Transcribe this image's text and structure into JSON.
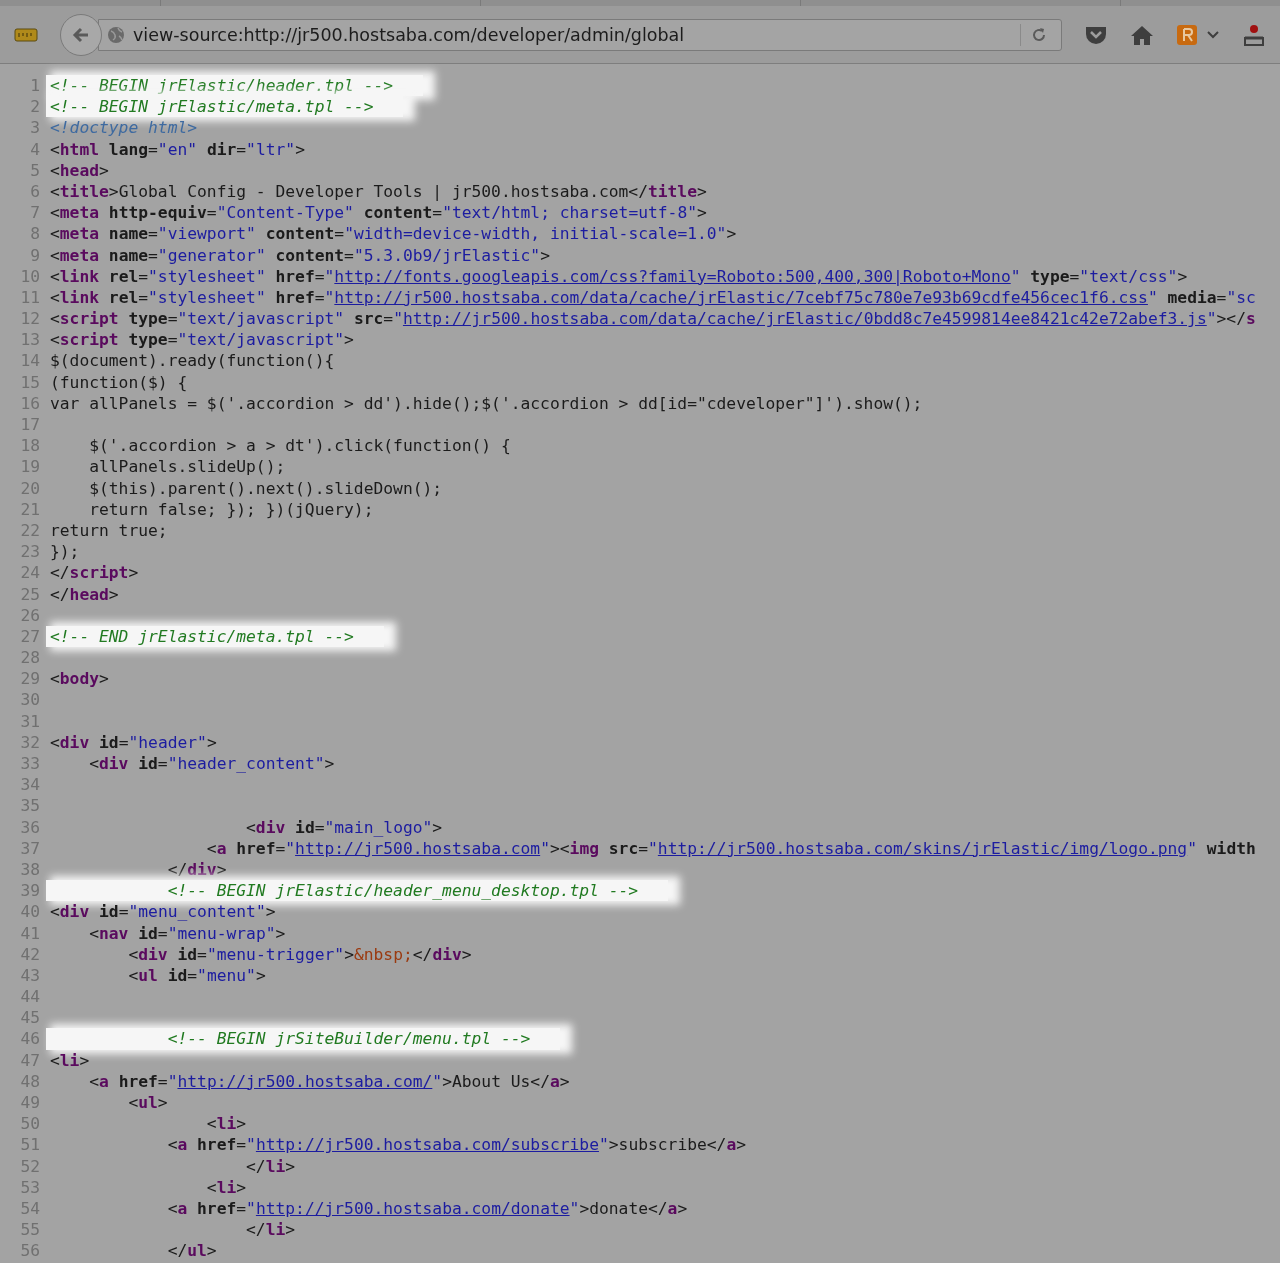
{
  "toolbar": {
    "url": "view-source:http://jr500.hostsaba.com/developer/admin/global"
  },
  "source_lines": [
    {
      "number": "1",
      "highlighted": true,
      "tokens": [
        {
          "kind": "comment",
          "text": "<!-- BEGIN jrElastic/header.tpl -->"
        }
      ]
    },
    {
      "number": "2",
      "highlighted": true,
      "tokens": [
        {
          "kind": "comment",
          "text": "<!-- BEGIN jrElastic/meta.tpl -->"
        }
      ]
    },
    {
      "number": "3",
      "highlighted": false,
      "tokens": [
        {
          "kind": "doctype",
          "text": "<!doctype html>"
        }
      ]
    },
    {
      "number": "4",
      "highlighted": false,
      "tokens": [
        {
          "kind": "plain",
          "text": "<"
        },
        {
          "kind": "tag",
          "text": "html"
        },
        {
          "kind": "attr",
          "text": " lang"
        },
        {
          "kind": "plain",
          "text": "="
        },
        {
          "kind": "value",
          "text": "\"en\""
        },
        {
          "kind": "attr",
          "text": " dir"
        },
        {
          "kind": "plain",
          "text": "="
        },
        {
          "kind": "value",
          "text": "\"ltr\""
        },
        {
          "kind": "plain",
          "text": ">"
        }
      ]
    },
    {
      "number": "5",
      "highlighted": false,
      "tokens": [
        {
          "kind": "plain",
          "text": "<"
        },
        {
          "kind": "tag",
          "text": "head"
        },
        {
          "kind": "plain",
          "text": ">"
        }
      ]
    },
    {
      "number": "6",
      "highlighted": false,
      "tokens": [
        {
          "kind": "plain",
          "text": "<"
        },
        {
          "kind": "tag",
          "text": "title"
        },
        {
          "kind": "plain",
          "text": ">Global Config - Developer Tools | jr500.hostsaba.com</"
        },
        {
          "kind": "tag",
          "text": "title"
        },
        {
          "kind": "plain",
          "text": ">"
        }
      ]
    },
    {
      "number": "7",
      "highlighted": false,
      "tokens": [
        {
          "kind": "plain",
          "text": "<"
        },
        {
          "kind": "tag",
          "text": "meta"
        },
        {
          "kind": "attr",
          "text": " http-equiv"
        },
        {
          "kind": "plain",
          "text": "="
        },
        {
          "kind": "value",
          "text": "\"Content-Type\""
        },
        {
          "kind": "attr",
          "text": " content"
        },
        {
          "kind": "plain",
          "text": "="
        },
        {
          "kind": "value",
          "text": "\"text/html; charset=utf-8\""
        },
        {
          "kind": "plain",
          "text": ">"
        }
      ]
    },
    {
      "number": "8",
      "highlighted": false,
      "tokens": [
        {
          "kind": "plain",
          "text": "<"
        },
        {
          "kind": "tag",
          "text": "meta"
        },
        {
          "kind": "attr",
          "text": " name"
        },
        {
          "kind": "plain",
          "text": "="
        },
        {
          "kind": "value",
          "text": "\"viewport\""
        },
        {
          "kind": "attr",
          "text": " content"
        },
        {
          "kind": "plain",
          "text": "="
        },
        {
          "kind": "value",
          "text": "\"width=device-width, initial-scale=1.0\""
        },
        {
          "kind": "plain",
          "text": ">"
        }
      ]
    },
    {
      "number": "9",
      "highlighted": false,
      "tokens": [
        {
          "kind": "plain",
          "text": "<"
        },
        {
          "kind": "tag",
          "text": "meta"
        },
        {
          "kind": "attr",
          "text": " name"
        },
        {
          "kind": "plain",
          "text": "="
        },
        {
          "kind": "value",
          "text": "\"generator\""
        },
        {
          "kind": "attr",
          "text": " content"
        },
        {
          "kind": "plain",
          "text": "="
        },
        {
          "kind": "value",
          "text": "\"5.3.0b9/jrElastic\""
        },
        {
          "kind": "plain",
          "text": ">"
        }
      ]
    },
    {
      "number": "10",
      "highlighted": false,
      "tokens": [
        {
          "kind": "plain",
          "text": "<"
        },
        {
          "kind": "tag",
          "text": "link"
        },
        {
          "kind": "attr",
          "text": " rel"
        },
        {
          "kind": "plain",
          "text": "="
        },
        {
          "kind": "value",
          "text": "\"stylesheet\""
        },
        {
          "kind": "attr",
          "text": " href"
        },
        {
          "kind": "plain",
          "text": "="
        },
        {
          "kind": "value",
          "text": "\""
        },
        {
          "kind": "link",
          "text": "http://fonts.googleapis.com/css?family=Roboto:500,400,300|Roboto+Mono"
        },
        {
          "kind": "value",
          "text": "\""
        },
        {
          "kind": "attr",
          "text": " type"
        },
        {
          "kind": "plain",
          "text": "="
        },
        {
          "kind": "value",
          "text": "\"text/css\""
        },
        {
          "kind": "plain",
          "text": ">"
        }
      ]
    },
    {
      "number": "11",
      "highlighted": false,
      "tokens": [
        {
          "kind": "plain",
          "text": "<"
        },
        {
          "kind": "tag",
          "text": "link"
        },
        {
          "kind": "attr",
          "text": " rel"
        },
        {
          "kind": "plain",
          "text": "="
        },
        {
          "kind": "value",
          "text": "\"stylesheet\""
        },
        {
          "kind": "attr",
          "text": " href"
        },
        {
          "kind": "plain",
          "text": "="
        },
        {
          "kind": "value",
          "text": "\""
        },
        {
          "kind": "link",
          "text": "http://jr500.hostsaba.com/data/cache/jrElastic/7cebf75c780e7e93b69cdfe456cec1f6.css"
        },
        {
          "kind": "value",
          "text": "\""
        },
        {
          "kind": "attr",
          "text": " media"
        },
        {
          "kind": "plain",
          "text": "="
        },
        {
          "kind": "value",
          "text": "\"sc"
        }
      ]
    },
    {
      "number": "12",
      "highlighted": false,
      "tokens": [
        {
          "kind": "plain",
          "text": "<"
        },
        {
          "kind": "tag",
          "text": "script"
        },
        {
          "kind": "attr",
          "text": " type"
        },
        {
          "kind": "plain",
          "text": "="
        },
        {
          "kind": "value",
          "text": "\"text/javascript\""
        },
        {
          "kind": "attr",
          "text": " src"
        },
        {
          "kind": "plain",
          "text": "="
        },
        {
          "kind": "value",
          "text": "\""
        },
        {
          "kind": "link",
          "text": "http://jr500.hostsaba.com/data/cache/jrElastic/0bdd8c7e4599814ee8421c42e72abef3.js"
        },
        {
          "kind": "value",
          "text": "\""
        },
        {
          "kind": "plain",
          "text": "></"
        },
        {
          "kind": "tag",
          "text": "s"
        }
      ]
    },
    {
      "number": "13",
      "highlighted": false,
      "tokens": [
        {
          "kind": "plain",
          "text": "<"
        },
        {
          "kind": "tag",
          "text": "script"
        },
        {
          "kind": "attr",
          "text": " type"
        },
        {
          "kind": "plain",
          "text": "="
        },
        {
          "kind": "value",
          "text": "\"text/javascript\""
        },
        {
          "kind": "plain",
          "text": ">"
        }
      ]
    },
    {
      "number": "14",
      "highlighted": false,
      "tokens": [
        {
          "kind": "plain",
          "text": "$(document).ready(function(){"
        }
      ]
    },
    {
      "number": "15",
      "highlighted": false,
      "tokens": [
        {
          "kind": "plain",
          "text": "(function($) {"
        }
      ]
    },
    {
      "number": "16",
      "highlighted": false,
      "tokens": [
        {
          "kind": "plain",
          "text": "var allPanels = $('.accordion > dd').hide();$('.accordion > dd[id=\"cdeveloper\"]').show();"
        }
      ]
    },
    {
      "number": "17",
      "highlighted": false
    },
    {
      "number": "18",
      "highlighted": false,
      "tokens": [
        {
          "kind": "plain",
          "text": "    $('.accordion > a > dt').click(function() {"
        }
      ]
    },
    {
      "number": "19",
      "highlighted": false,
      "tokens": [
        {
          "kind": "plain",
          "text": "    allPanels.slideUp();"
        }
      ]
    },
    {
      "number": "20",
      "highlighted": false,
      "tokens": [
        {
          "kind": "plain",
          "text": "    $(this).parent().next().slideDown();"
        }
      ]
    },
    {
      "number": "21",
      "highlighted": false,
      "tokens": [
        {
          "kind": "plain",
          "text": "    return false; }); })(jQuery);"
        }
      ]
    },
    {
      "number": "22",
      "highlighted": false,
      "tokens": [
        {
          "kind": "plain",
          "text": "return true;"
        }
      ]
    },
    {
      "number": "23",
      "highlighted": false,
      "tokens": [
        {
          "kind": "plain",
          "text": "});"
        }
      ]
    },
    {
      "number": "24",
      "highlighted": false,
      "tokens": [
        {
          "kind": "plain",
          "text": "</"
        },
        {
          "kind": "tag",
          "text": "script"
        },
        {
          "kind": "plain",
          "text": ">"
        }
      ]
    },
    {
      "number": "25",
      "highlighted": false,
      "tokens": [
        {
          "kind": "plain",
          "text": "</"
        },
        {
          "kind": "tag",
          "text": "head"
        },
        {
          "kind": "plain",
          "text": ">"
        }
      ]
    },
    {
      "number": "26",
      "highlighted": false
    },
    {
      "number": "27",
      "highlighted": true,
      "tokens": [
        {
          "kind": "comment",
          "text": "<!-- END jrElastic/meta.tpl -->"
        }
      ]
    },
    {
      "number": "28",
      "highlighted": false
    },
    {
      "number": "29",
      "highlighted": false,
      "tokens": [
        {
          "kind": "plain",
          "text": "<"
        },
        {
          "kind": "tag",
          "text": "body"
        },
        {
          "kind": "plain",
          "text": ">"
        }
      ]
    },
    {
      "number": "30",
      "highlighted": false
    },
    {
      "number": "31",
      "highlighted": false
    },
    {
      "number": "32",
      "highlighted": false,
      "tokens": [
        {
          "kind": "plain",
          "text": "<"
        },
        {
          "kind": "tag",
          "text": "div"
        },
        {
          "kind": "attr",
          "text": " id"
        },
        {
          "kind": "plain",
          "text": "="
        },
        {
          "kind": "value",
          "text": "\"header\""
        },
        {
          "kind": "plain",
          "text": ">"
        }
      ]
    },
    {
      "number": "33",
      "highlighted": false,
      "tokens": [
        {
          "kind": "plain",
          "text": "    <"
        },
        {
          "kind": "tag",
          "text": "div"
        },
        {
          "kind": "attr",
          "text": " id"
        },
        {
          "kind": "plain",
          "text": "="
        },
        {
          "kind": "value",
          "text": "\"header_content\""
        },
        {
          "kind": "plain",
          "text": ">"
        }
      ]
    },
    {
      "number": "34",
      "highlighted": false
    },
    {
      "number": "35",
      "highlighted": false
    },
    {
      "number": "36",
      "highlighted": false,
      "tokens": [
        {
          "kind": "plain",
          "text": "                    <"
        },
        {
          "kind": "tag",
          "text": "div"
        },
        {
          "kind": "attr",
          "text": " id"
        },
        {
          "kind": "plain",
          "text": "="
        },
        {
          "kind": "value",
          "text": "\"main_logo\""
        },
        {
          "kind": "plain",
          "text": ">"
        }
      ]
    },
    {
      "number": "37",
      "highlighted": false,
      "tokens": [
        {
          "kind": "plain",
          "text": "                <"
        },
        {
          "kind": "tag",
          "text": "a"
        },
        {
          "kind": "attr",
          "text": " href"
        },
        {
          "kind": "plain",
          "text": "="
        },
        {
          "kind": "value",
          "text": "\""
        },
        {
          "kind": "link",
          "text": "http://jr500.hostsaba.com"
        },
        {
          "kind": "value",
          "text": "\""
        },
        {
          "kind": "plain",
          "text": "><"
        },
        {
          "kind": "tag",
          "text": "img"
        },
        {
          "kind": "attr",
          "text": " src"
        },
        {
          "kind": "plain",
          "text": "="
        },
        {
          "kind": "value",
          "text": "\""
        },
        {
          "kind": "link",
          "text": "http://jr500.hostsaba.com/skins/jrElastic/img/logo.png"
        },
        {
          "kind": "value",
          "text": "\""
        },
        {
          "kind": "attr",
          "text": " width"
        }
      ]
    },
    {
      "number": "38",
      "highlighted": false,
      "tokens": [
        {
          "kind": "plain",
          "text": "            </"
        },
        {
          "kind": "tag",
          "text": "div"
        },
        {
          "kind": "plain",
          "text": ">"
        }
      ]
    },
    {
      "number": "39",
      "highlighted": true,
      "tokens": [
        {
          "kind": "comment",
          "text": "            <!-- BEGIN jrElastic/header_menu_desktop.tpl -->"
        }
      ]
    },
    {
      "number": "40",
      "highlighted": false,
      "tokens": [
        {
          "kind": "plain",
          "text": "<"
        },
        {
          "kind": "tag",
          "text": "div"
        },
        {
          "kind": "attr",
          "text": " id"
        },
        {
          "kind": "plain",
          "text": "="
        },
        {
          "kind": "value",
          "text": "\"menu_content\""
        },
        {
          "kind": "plain",
          "text": ">"
        }
      ]
    },
    {
      "number": "41",
      "highlighted": false,
      "tokens": [
        {
          "kind": "plain",
          "text": "    <"
        },
        {
          "kind": "tag",
          "text": "nav"
        },
        {
          "kind": "attr",
          "text": " id"
        },
        {
          "kind": "plain",
          "text": "="
        },
        {
          "kind": "value",
          "text": "\"menu-wrap\""
        },
        {
          "kind": "plain",
          "text": ">"
        }
      ]
    },
    {
      "number": "42",
      "highlighted": false,
      "tokens": [
        {
          "kind": "plain",
          "text": "        <"
        },
        {
          "kind": "tag",
          "text": "div"
        },
        {
          "kind": "attr",
          "text": " id"
        },
        {
          "kind": "plain",
          "text": "="
        },
        {
          "kind": "value",
          "text": "\"menu-trigger\""
        },
        {
          "kind": "plain",
          "text": ">"
        },
        {
          "kind": "entity",
          "text": "&nbsp;"
        },
        {
          "kind": "plain",
          "text": "</"
        },
        {
          "kind": "tag",
          "text": "div"
        },
        {
          "kind": "plain",
          "text": ">"
        }
      ]
    },
    {
      "number": "43",
      "highlighted": false,
      "tokens": [
        {
          "kind": "plain",
          "text": "        <"
        },
        {
          "kind": "tag",
          "text": "ul"
        },
        {
          "kind": "attr",
          "text": " id"
        },
        {
          "kind": "plain",
          "text": "="
        },
        {
          "kind": "value",
          "text": "\"menu\""
        },
        {
          "kind": "plain",
          "text": ">"
        }
      ]
    },
    {
      "number": "44",
      "highlighted": false
    },
    {
      "number": "45",
      "highlighted": false
    },
    {
      "number": "46",
      "highlighted": true,
      "tokens": [
        {
          "kind": "comment",
          "text": "            <!-- BEGIN jrSiteBuilder/menu.tpl -->"
        }
      ]
    },
    {
      "number": "47",
      "highlighted": false,
      "tokens": [
        {
          "kind": "plain",
          "text": "<"
        },
        {
          "kind": "tag",
          "text": "li"
        },
        {
          "kind": "plain",
          "text": ">"
        }
      ]
    },
    {
      "number": "48",
      "highlighted": false,
      "tokens": [
        {
          "kind": "plain",
          "text": "    <"
        },
        {
          "kind": "tag",
          "text": "a"
        },
        {
          "kind": "attr",
          "text": " href"
        },
        {
          "kind": "plain",
          "text": "="
        },
        {
          "kind": "value",
          "text": "\""
        },
        {
          "kind": "link",
          "text": "http://jr500.hostsaba.com/"
        },
        {
          "kind": "value",
          "text": "\""
        },
        {
          "kind": "plain",
          "text": ">About Us</"
        },
        {
          "kind": "tag",
          "text": "a"
        },
        {
          "kind": "plain",
          "text": ">"
        }
      ]
    },
    {
      "number": "49",
      "highlighted": false,
      "tokens": [
        {
          "kind": "plain",
          "text": "        <"
        },
        {
          "kind": "tag",
          "text": "ul"
        },
        {
          "kind": "plain",
          "text": ">"
        }
      ]
    },
    {
      "number": "50",
      "highlighted": false,
      "tokens": [
        {
          "kind": "plain",
          "text": "                <"
        },
        {
          "kind": "tag",
          "text": "li"
        },
        {
          "kind": "plain",
          "text": ">"
        }
      ]
    },
    {
      "number": "51",
      "highlighted": false,
      "tokens": [
        {
          "kind": "plain",
          "text": "            <"
        },
        {
          "kind": "tag",
          "text": "a"
        },
        {
          "kind": "attr",
          "text": " href"
        },
        {
          "kind": "plain",
          "text": "="
        },
        {
          "kind": "value",
          "text": "\""
        },
        {
          "kind": "link",
          "text": "http://jr500.hostsaba.com/subscribe"
        },
        {
          "kind": "value",
          "text": "\""
        },
        {
          "kind": "plain",
          "text": ">subscribe</"
        },
        {
          "kind": "tag",
          "text": "a"
        },
        {
          "kind": "plain",
          "text": ">"
        }
      ]
    },
    {
      "number": "52",
      "highlighted": false,
      "tokens": [
        {
          "kind": "plain",
          "text": "                    </"
        },
        {
          "kind": "tag",
          "text": "li"
        },
        {
          "kind": "plain",
          "text": ">"
        }
      ]
    },
    {
      "number": "53",
      "highlighted": false,
      "tokens": [
        {
          "kind": "plain",
          "text": "                <"
        },
        {
          "kind": "tag",
          "text": "li"
        },
        {
          "kind": "plain",
          "text": ">"
        }
      ]
    },
    {
      "number": "54",
      "highlighted": false,
      "tokens": [
        {
          "kind": "plain",
          "text": "            <"
        },
        {
          "kind": "tag",
          "text": "a"
        },
        {
          "kind": "attr",
          "text": " href"
        },
        {
          "kind": "plain",
          "text": "="
        },
        {
          "kind": "value",
          "text": "\""
        },
        {
          "kind": "link",
          "text": "http://jr500.hostsaba.com/donate"
        },
        {
          "kind": "value",
          "text": "\""
        },
        {
          "kind": "plain",
          "text": ">donate</"
        },
        {
          "kind": "tag",
          "text": "a"
        },
        {
          "kind": "plain",
          "text": ">"
        }
      ]
    },
    {
      "number": "55",
      "highlighted": false,
      "tokens": [
        {
          "kind": "plain",
          "text": "                    </"
        },
        {
          "kind": "tag",
          "text": "li"
        },
        {
          "kind": "plain",
          "text": ">"
        }
      ]
    },
    {
      "number": "56",
      "highlighted": false,
      "tokens": [
        {
          "kind": "plain",
          "text": "            </"
        },
        {
          "kind": "tag",
          "text": "ul"
        },
        {
          "kind": "plain",
          "text": ">"
        }
      ]
    }
  ]
}
